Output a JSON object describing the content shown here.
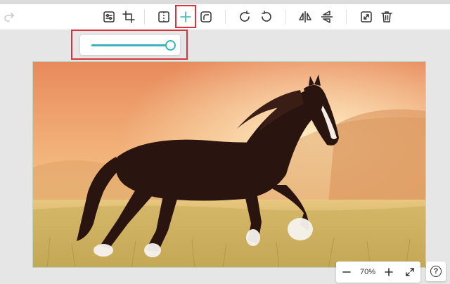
{
  "toolbar": {
    "tools": [
      {
        "name": "adjust-icon"
      },
      {
        "name": "crop-icon"
      },
      {
        "name": "border-icon"
      },
      {
        "name": "crosshair-icon"
      },
      {
        "name": "rounded-corner-icon"
      },
      {
        "name": "rotate-clockwise-icon"
      },
      {
        "name": "rotate-counterclockwise-icon"
      },
      {
        "name": "flip-horizontal-icon"
      },
      {
        "name": "flip-vertical-icon"
      },
      {
        "name": "resize-icon"
      },
      {
        "name": "delete-icon"
      }
    ],
    "active_tool": "crosshair-icon"
  },
  "slider": {
    "value_fraction": 1.0,
    "accent_color": "#3bb3b8"
  },
  "canvas": {
    "image_subject": "horse-photo"
  },
  "zoom": {
    "level": "70%",
    "minus_icon": "minus-icon",
    "plus_icon": "plus-icon",
    "fit_icon": "expand-icon"
  },
  "help": {
    "label": "?"
  },
  "colors": {
    "highlight": "#d6343f",
    "icon": "#333333"
  }
}
